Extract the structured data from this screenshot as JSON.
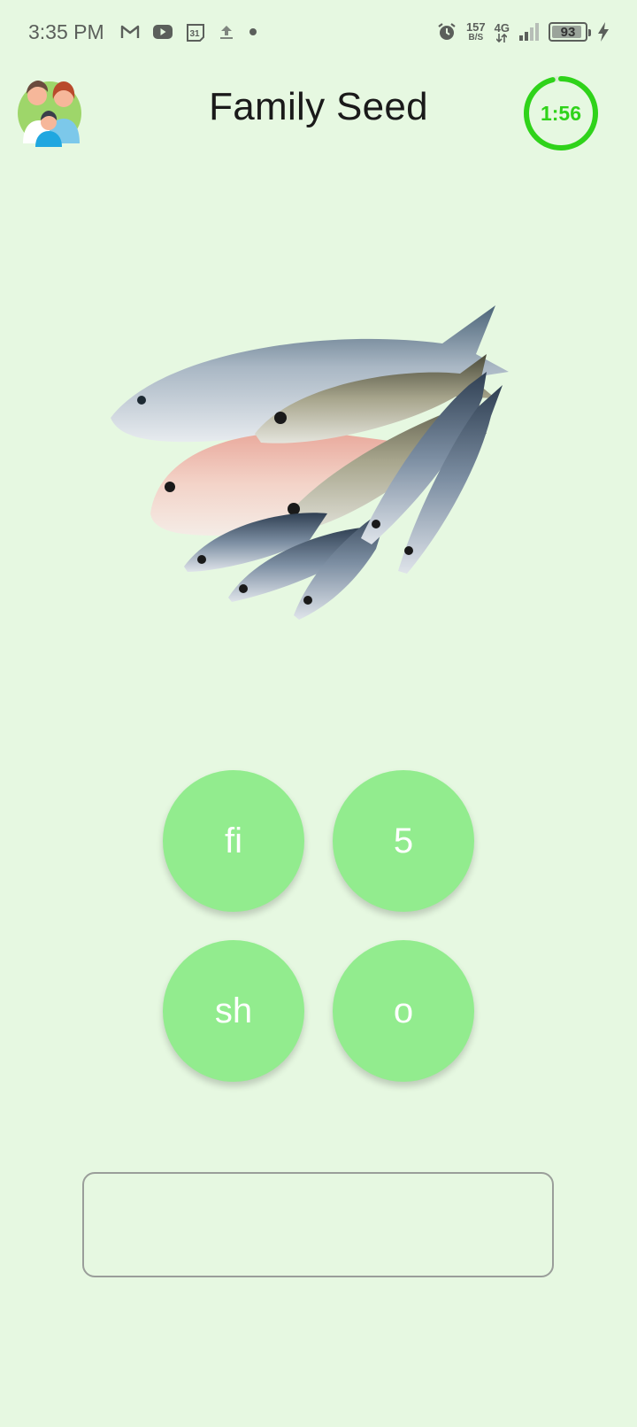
{
  "status_bar": {
    "time": "3:35 PM",
    "icons_left": [
      "gmail-icon",
      "youtube-icon",
      "calendar-icon",
      "upload-icon",
      "dot-icon"
    ],
    "calendar_day": "31",
    "net_speed": "157",
    "net_speed_unit": "B/S",
    "network": "4G",
    "battery": "93",
    "battery_level": 0.93
  },
  "header": {
    "title": "Family Seed",
    "avatar_icon": "family-avatar-icon",
    "timer": {
      "label": "1:56",
      "progress": 0.96,
      "color": "#2fd31a"
    }
  },
  "question": {
    "image": "fish-photo"
  },
  "choices": [
    {
      "label": "fi"
    },
    {
      "label": "5"
    },
    {
      "label": "sh"
    },
    {
      "label": "o"
    }
  ],
  "answer": {
    "value": "",
    "placeholder": ""
  },
  "colors": {
    "background": "#e6f8e1",
    "button": "#92ec8e",
    "accent": "#2fd31a"
  }
}
